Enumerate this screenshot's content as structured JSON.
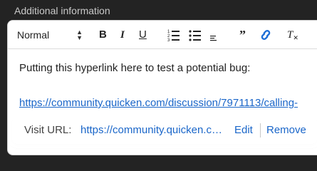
{
  "section": {
    "label": "Additional information"
  },
  "toolbar": {
    "heading_value": "Normal",
    "bold_label": "B",
    "italic_label": "I",
    "underline_label": "U",
    "quote_label": "”",
    "clear_label": "T",
    "icons": [
      "select-arrows-icon",
      "ordered-list-icon",
      "bullet-list-icon",
      "align-icon",
      "quote-icon",
      "link-icon",
      "clear-format-icon"
    ],
    "link_active_color": "#1f6fd6"
  },
  "editor": {
    "text": "Putting this hyperlink here to test a potential bug:",
    "link_text": "https://community.quicken.com/discussion/7971113/calling-"
  },
  "link_popup": {
    "label": "Visit URL:",
    "url": "https://community.quicken.com/discussion/7971113/calling-",
    "edit_label": "Edit",
    "remove_label": "Remove"
  },
  "colors": {
    "link": "#1a66c9",
    "background": "#232323"
  }
}
